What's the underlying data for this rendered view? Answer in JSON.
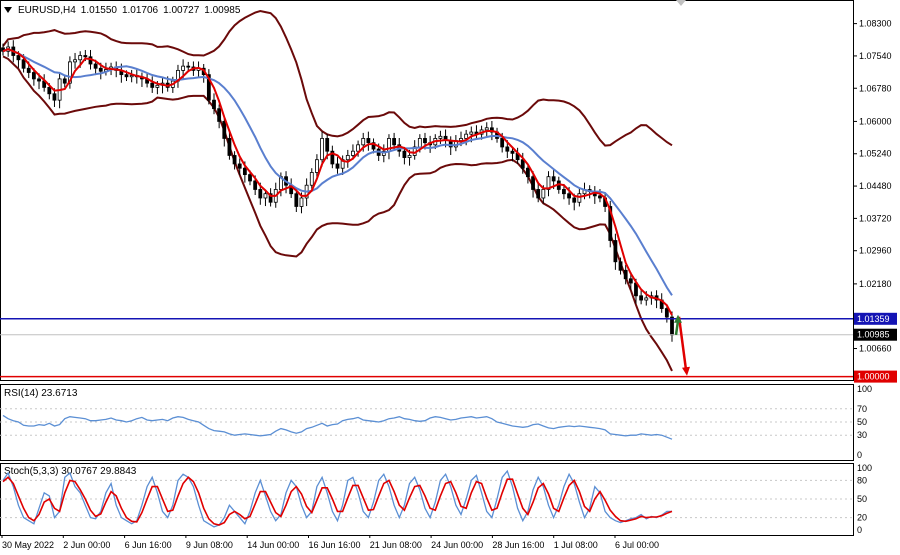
{
  "header": {
    "symbol": "EURUSD,H4",
    "open": "1.01550",
    "high": "1.01706",
    "low": "1.00727",
    "close": "1.00985"
  },
  "rsi_label": "RSI(14) 23.6713",
  "stoch_label": "Stoch(5,3,3) 30.0767 29.8843",
  "colors": {
    "bull": "#2e7d32",
    "bear": "#000000",
    "bands": "#6b0a0a",
    "fast_ma": "#e00000",
    "slow_ma": "#5a7fcf",
    "support_line": "#1414b4",
    "target_line": "#e00000",
    "indicator": "#5b8fd4"
  },
  "chart_data": [
    {
      "type": "candlestick",
      "pane": "main",
      "y_ticks": [
        "1.08300",
        "1.07540",
        "1.06780",
        "1.06000",
        "1.05240",
        "1.04480",
        "1.03720",
        "1.02960",
        "1.02180",
        "1.01359",
        "1.00985",
        "1.00660",
        "1.00000"
      ],
      "ylim": [
        0.9992,
        1.0862
      ],
      "x_ticks": [
        "30 May 2022",
        "2 Jun 00:00",
        "6 Jun 16:00",
        "9 Jun 08:00",
        "14 Jun 00:00",
        "16 Jun 16:00",
        "21 Jun 08:00",
        "24 Jun 00:00",
        "28 Jun 16:00",
        "1 Jul 08:00",
        "6 Jul 00:00"
      ],
      "close": [
        1.0765,
        1.0775,
        1.0755,
        1.0745,
        1.0725,
        1.0715,
        1.07,
        1.0695,
        1.068,
        1.0665,
        1.065,
        1.07,
        1.069,
        1.074,
        1.0745,
        1.0755,
        1.0752,
        1.0735,
        1.0725,
        1.0718,
        1.0722,
        1.0728,
        1.072,
        1.071,
        1.0705,
        1.0708,
        1.0705,
        1.07,
        1.069,
        1.068,
        1.0685,
        1.069,
        1.068,
        1.0695,
        1.072,
        1.073,
        1.0728,
        1.072,
        1.0725,
        1.071,
        1.065,
        1.063,
        1.06,
        1.056,
        1.052,
        1.05,
        1.049,
        1.0475,
        1.046,
        1.044,
        1.042,
        1.043,
        1.041,
        1.044,
        1.047,
        1.045,
        1.043,
        1.04,
        1.042,
        1.045,
        1.048,
        1.051,
        1.056,
        1.053,
        1.05,
        1.049,
        1.051,
        1.052,
        1.053,
        1.0545,
        1.056,
        1.055,
        1.0535,
        1.052,
        1.053,
        1.056,
        1.0545,
        1.053,
        1.0515,
        1.052,
        1.054,
        1.056,
        1.055,
        1.0545,
        1.056,
        1.0565,
        1.0555,
        1.054,
        1.0555,
        1.056,
        1.057,
        1.0575,
        1.057,
        1.058,
        1.0585,
        1.0575,
        1.056,
        1.054,
        1.053,
        1.0525,
        1.051,
        1.049,
        1.047,
        1.044,
        1.042,
        1.044,
        1.047,
        1.046,
        1.044,
        1.043,
        1.042,
        1.041,
        1.043,
        1.044,
        1.0435,
        1.0425,
        1.042,
        1.04,
        1.032,
        1.027,
        1.025,
        1.023,
        1.022,
        1.019,
        1.018,
        1.0185,
        1.019,
        1.018,
        1.016,
        1.014,
        1.0098
      ],
      "bollinger": {
        "upper_label": "upper band",
        "lower_label": "lower band"
      },
      "levels": [
        {
          "value": 1.01359,
          "label": "1.01359",
          "color": "#1414b4"
        },
        {
          "value": 1.0,
          "label": "1.00000",
          "color": "#e00000"
        }
      ],
      "current_price": {
        "value": 1.00985,
        "label": "1.00985"
      }
    },
    {
      "type": "line",
      "pane": "rsi",
      "title": "RSI(14) 23.6713",
      "y_ticks": [
        "100",
        "70",
        "50",
        "30",
        "0"
      ],
      "ylim": [
        0,
        100
      ],
      "values": [
        60,
        55,
        52,
        50,
        45,
        44,
        44,
        46,
        45,
        48,
        44,
        46,
        55,
        58,
        57,
        56,
        55,
        52,
        52,
        53,
        54,
        56,
        53,
        52,
        50,
        52,
        55,
        57,
        53,
        52,
        53,
        54,
        52,
        56,
        58,
        57,
        54,
        52,
        50,
        45,
        40,
        37,
        36,
        35,
        32,
        30,
        31,
        32,
        31,
        30,
        29,
        30,
        31,
        36,
        40,
        38,
        35,
        33,
        35,
        40,
        42,
        45,
        48,
        44,
        46,
        47,
        52,
        54,
        55,
        57,
        53,
        52,
        51,
        50,
        52,
        55,
        56,
        58,
        55,
        54,
        52,
        51,
        52,
        56,
        58,
        57,
        55,
        53,
        54,
        56,
        57,
        58,
        56,
        57,
        58,
        55,
        50,
        48,
        46,
        44,
        43,
        42,
        43,
        46,
        47,
        44,
        41,
        40,
        42,
        43,
        44,
        43,
        44,
        43,
        42,
        41,
        40,
        38,
        32,
        31,
        30,
        29,
        30,
        30,
        32,
        31,
        30,
        31,
        30,
        27,
        24
      ]
    },
    {
      "type": "line",
      "pane": "stoch",
      "title": "Stoch(5,3,3) 30.0767 29.8843",
      "y_ticks": [
        "100",
        "80",
        "50",
        "20",
        "0"
      ],
      "ylim": [
        0,
        100
      ],
      "series": [
        {
          "name": "30.0767",
          "values": [
            80,
            92,
            70,
            40,
            20,
            15,
            10,
            35,
            60,
            55,
            20,
            30,
            85,
            92,
            70,
            60,
            40,
            20,
            18,
            30,
            60,
            75,
            40,
            20,
            15,
            10,
            15,
            40,
            70,
            85,
            60,
            30,
            20,
            40,
            80,
            90,
            85,
            70,
            40,
            15,
            10,
            5,
            8,
            20,
            40,
            30,
            20,
            10,
            30,
            60,
            80,
            55,
            30,
            15,
            25,
            60,
            80,
            70,
            40,
            20,
            30,
            70,
            85,
            60,
            30,
            15,
            40,
            80,
            85,
            60,
            30,
            20,
            45,
            80,
            90,
            70,
            40,
            20,
            40,
            75,
            85,
            65,
            35,
            20,
            45,
            80,
            90,
            70,
            40,
            25,
            50,
            80,
            88,
            60,
            30,
            20,
            50,
            85,
            95,
            70,
            35,
            15,
            30,
            65,
            85,
            70,
            40,
            20,
            40,
            70,
            90,
            75,
            45,
            20,
            35,
            70,
            60,
            30,
            20,
            15,
            12,
            15,
            18,
            20,
            25,
            18,
            22,
            20,
            24,
            30,
            30
          ]
        },
        {
          "name": "29.8843",
          "values": [
            78,
            85,
            75,
            55,
            35,
            20,
            15,
            25,
            45,
            50,
            35,
            30,
            60,
            80,
            78,
            65,
            50,
            32,
            22,
            26,
            45,
            62,
            55,
            35,
            20,
            14,
            13,
            28,
            50,
            70,
            70,
            50,
            30,
            32,
            55,
            75,
            85,
            78,
            60,
            35,
            18,
            10,
            8,
            12,
            25,
            30,
            25,
            18,
            22,
            42,
            62,
            62,
            45,
            28,
            22,
            40,
            62,
            70,
            58,
            38,
            28,
            48,
            68,
            68,
            50,
            30,
            30,
            52,
            72,
            72,
            52,
            32,
            33,
            55,
            75,
            80,
            62,
            40,
            32,
            52,
            70,
            72,
            55,
            35,
            32,
            55,
            75,
            78,
            60,
            38,
            35,
            60,
            78,
            75,
            52,
            32,
            35,
            60,
            82,
            82,
            58,
            35,
            25,
            45,
            68,
            75,
            58,
            35,
            30,
            52,
            72,
            80,
            62,
            38,
            30,
            50,
            62,
            48,
            32,
            22,
            15,
            14,
            16,
            18,
            22,
            20,
            21,
            21,
            23,
            27,
            30
          ]
        }
      ]
    }
  ]
}
